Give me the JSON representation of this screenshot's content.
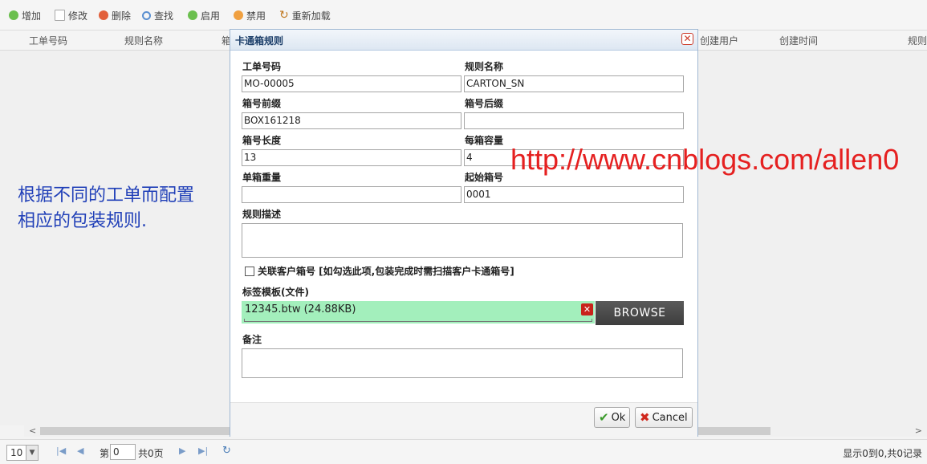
{
  "toolbar": {
    "add": "增加",
    "edit": "修改",
    "delete": "删除",
    "find": "查找",
    "enable": "启用",
    "disable": "禁用",
    "reload": "重新加载"
  },
  "grid": {
    "columns": [
      "工单号码",
      "规则名称",
      "箱",
      "创建用户",
      "创建时间",
      "规则"
    ]
  },
  "note": {
    "line1": "根据不同的工单而配置",
    "line2": "相应的包装规则."
  },
  "watermark": "http://www.cnblogs.com/allen0",
  "dialog": {
    "title": "卡通箱规则",
    "close": "✕",
    "fields": {
      "work_order": {
        "label": "工单号码",
        "value": "MO-00005"
      },
      "rule_name": {
        "label": "规则名称",
        "value": "CARTON_SN"
      },
      "box_prefix": {
        "label": "箱号前缀",
        "value": "BOX161218"
      },
      "box_suffix": {
        "label": "箱号后缀",
        "value": ""
      },
      "box_length": {
        "label": "箱号长度",
        "value": "13"
      },
      "box_capacity": {
        "label": "每箱容量",
        "value": "4"
      },
      "box_weight": {
        "label": "单箱重量",
        "value": ""
      },
      "start_no": {
        "label": "起始箱号",
        "value": "0001"
      },
      "rule_desc": {
        "label": "规则描述"
      },
      "remarks": {
        "label": "备注"
      }
    },
    "link_customer_box": "关联客户箱号 [如勾选此项,包装完成时需扫描客户卡通箱号]",
    "label_template_label": "标签模板(文件)",
    "file_name": "12345.btw (24.88KB)",
    "browse": "BROWSE",
    "ok": "Ok",
    "cancel": "Cancel"
  },
  "pager": {
    "page_size": "10",
    "page_prefix": "第",
    "page_value": "0",
    "page_total": "共0页",
    "info": "显示0到0,共0记录"
  }
}
